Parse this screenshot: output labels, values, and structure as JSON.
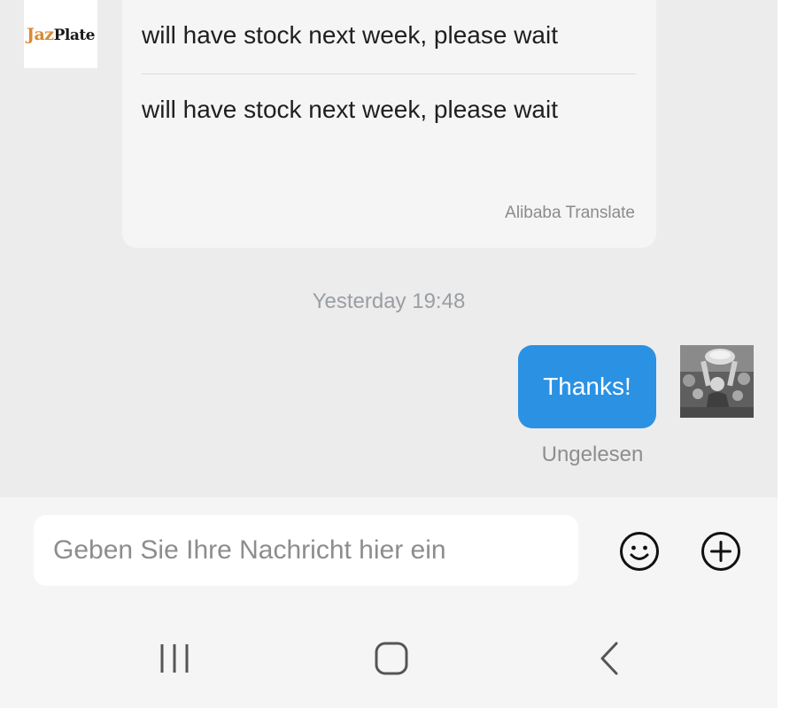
{
  "chat": {
    "seller": {
      "logo_part1": "Jaz",
      "logo_part2": "Plate",
      "logo_color": "#d98a33"
    },
    "incoming_message": {
      "original_text": "will have stock next week, please wait",
      "translated_text": "will have stock next week, please wait",
      "translation_credit": "Alibaba Translate"
    },
    "timestamp": "Yesterday 19:48",
    "outgoing_message": {
      "text": "Thanks!",
      "status": "Ungelesen",
      "bubble_color": "#2b91e3"
    }
  },
  "composer": {
    "placeholder": "Geben Sie Ihre Nachricht hier ein",
    "value": "",
    "emoji_icon": "smiley-face-icon",
    "add_icon": "plus-circle-icon"
  },
  "system_nav": {
    "recents_icon": "recent-apps-icon",
    "home_icon": "home-icon",
    "back_icon": "back-chevron-icon"
  }
}
